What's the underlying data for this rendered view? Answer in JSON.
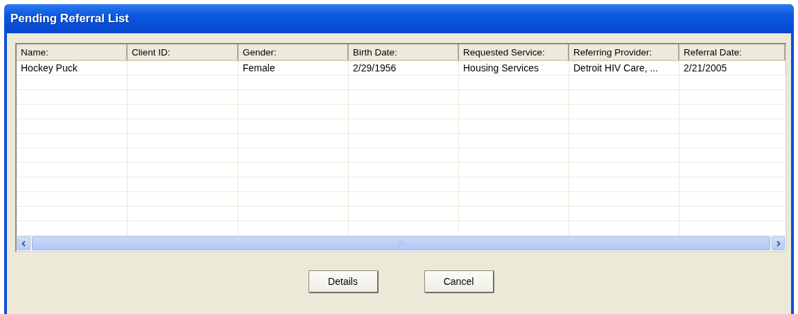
{
  "window": {
    "title": "Pending Referral List"
  },
  "table": {
    "columns": [
      "Name:",
      "Client ID:",
      "Gender:",
      "Birth Date:",
      "Requested Service:",
      "Referring Provider:",
      "Referral Date:"
    ],
    "rows": [
      {
        "cells": [
          "Hockey Puck",
          "",
          "Female",
          "2/29/1956",
          "Housing Services",
          "Detroit HIV Care, ...",
          "2/21/2005"
        ]
      }
    ]
  },
  "buttons": [
    "Details",
    "Cancel"
  ]
}
